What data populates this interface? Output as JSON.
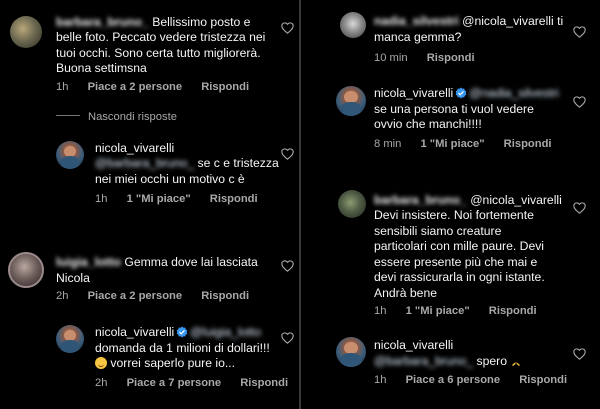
{
  "left": {
    "c1": {
      "username": "barbara_bruno_",
      "lines": [
        "Bellissimo posto e",
        "belle foto. Peccato vedere tristezza nei",
        "tuoi occhi. Sono certa tutto migliorerà.",
        "Buona settimsna"
      ],
      "time": "1h",
      "likes": "Piace a 2 persone",
      "reply": "Rispondi"
    },
    "hide_replies": "Nascondi risposte",
    "r1": {
      "username": "nicola_vivarelli",
      "mention": "@barbara_bruno_",
      "lines": [
        "se c e tristezza",
        "nei miei occhi un motivo c è"
      ],
      "time": "1h",
      "likes": "1 \"Mi piace\"",
      "reply": "Rispondi"
    },
    "c2": {
      "username": "luigia_lotto",
      "lines": [
        "Gemma dove lai lasciata",
        "Nicola"
      ],
      "time": "2h",
      "likes": "Piace a 2 persone",
      "reply": "Rispondi"
    },
    "r2": {
      "username": "nicola_vivarelli",
      "mention": "@luigia_lotto",
      "lines": [
        "domanda da 1 milioni di dollari!!!",
        "vorrei saperlo pure io..."
      ],
      "time": "2h",
      "likes": "Piace a 7 persone",
      "reply": "Rispondi"
    }
  },
  "right": {
    "c1": {
      "username": "nadia_silvestri",
      "lines": [
        "@nicola_vivarelli ti",
        "manca gemma?"
      ],
      "time": "10 min",
      "reply": "Rispondi"
    },
    "r1": {
      "username": "nicola_vivarelli",
      "mention": "@nadia_silvestri",
      "lines": [
        "se una persona ti vuol vedere",
        "ovvio che manchi!!!!"
      ],
      "time": "8 min",
      "likes": "1 \"Mi piace\"",
      "reply": "Rispondi"
    },
    "c2": {
      "username": "barbara_bruno_",
      "lines": [
        "@nicola_vivarelli",
        "Devi insistere. Noi fortemente",
        "sensibili siamo creature",
        "particolari con mille paure. Devi",
        "essere presente più che mai e",
        "devi rassicurarla in ogni istante.",
        "Andrà bene"
      ],
      "time": "1h",
      "likes": "1 \"Mi piace\"",
      "reply": "Rispondi"
    },
    "r2": {
      "username": "nicola_vivarelli",
      "mention": "@barbara_bruno_",
      "lines": [
        "spero"
      ],
      "time": "1h",
      "likes": "Piace a 6 persone",
      "reply": "Rispondi"
    }
  },
  "colors": {
    "background": "#000000",
    "text": "#f5f5f5",
    "meta": "#a8a8a8",
    "verified": "#3897f0"
  },
  "icons": [
    "heart-icon",
    "verified-badge-icon",
    "praying-hands-emoji",
    "smile-emoji"
  ]
}
